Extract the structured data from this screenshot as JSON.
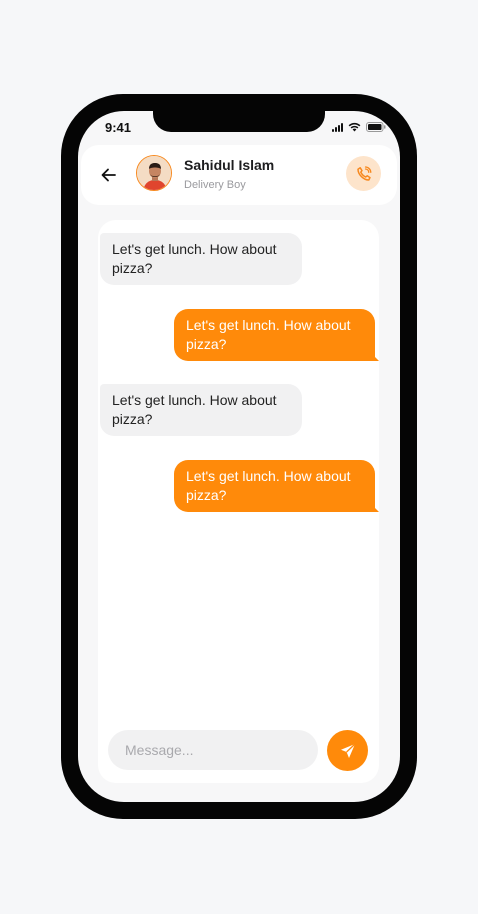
{
  "status": {
    "time": "9:41"
  },
  "contact": {
    "name": "Sahidul Islam",
    "role": "Delivery Boy"
  },
  "messages": [
    {
      "direction": "in",
      "text": "Let's get lunch. How about pizza?"
    },
    {
      "direction": "out",
      "text": "Let's get lunch. How about pizza?"
    },
    {
      "direction": "in",
      "text": "Let's get lunch. How about pizza?"
    },
    {
      "direction": "out",
      "text": "Let's get lunch. How about pizza?"
    }
  ],
  "composer": {
    "placeholder": "Message..."
  },
  "icons": {
    "back": "arrow-left-icon",
    "call": "phone-icon",
    "send": "send-icon"
  },
  "colors": {
    "accent": "#ff8a0a",
    "accent_soft": "#fde4cb",
    "bubble_in": "#f1f1f2"
  }
}
